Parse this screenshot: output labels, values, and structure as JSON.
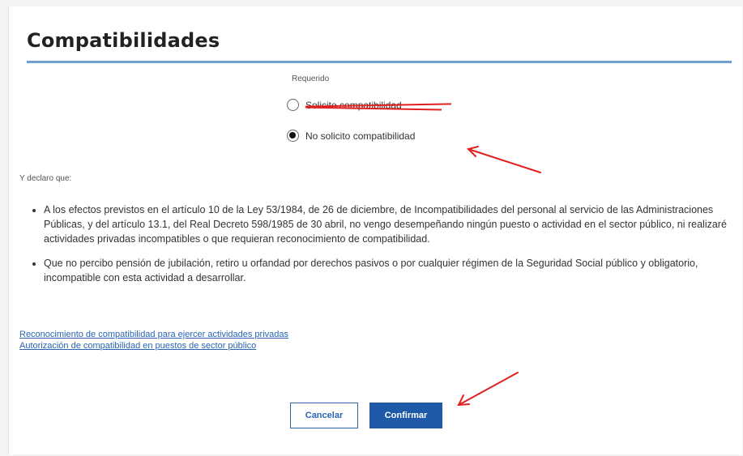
{
  "dialog": {
    "title": "Compatibilidades",
    "required_label": "Requerido",
    "options": [
      {
        "label": "Solicito compatibilidad",
        "selected": false,
        "struck_out": true
      },
      {
        "label": "No solicito compatibilidad",
        "selected": true
      }
    ],
    "declare_label": "Y declaro que:",
    "bullets": [
      "A los efectos previstos en el artículo 10 de la Ley 53/1984, de 26 de diciembre, de Incompatibilidades del personal al servicio de las Administraciones Públicas, y del artículo 13.1, del Real Decreto 598/1985 de 30 abril, no vengo desempeñando ningún puesto o actividad en el sector público, ni realizaré actividades privadas incompatibles o que requieran reconocimiento de compatibilidad.",
      "Que no percibo pensión de jubilación, retiro u orfandad por derechos pasivos o por cualquier régimen de la Seguridad Social público y obligatorio, incompatible con esta actividad a desarrollar."
    ],
    "links": [
      "Reconocimiento de compatibilidad para ejercer actividades privadas",
      "Autorización de compatibilidad en puestos de sector público"
    ],
    "buttons": {
      "cancel": "Cancelar",
      "confirm": "Confirmar"
    }
  },
  "colors": {
    "accent": "#1e5aa8",
    "title_rule": "#6f9fd3",
    "annotation": "#e02020",
    "link": "#2a64b3"
  }
}
